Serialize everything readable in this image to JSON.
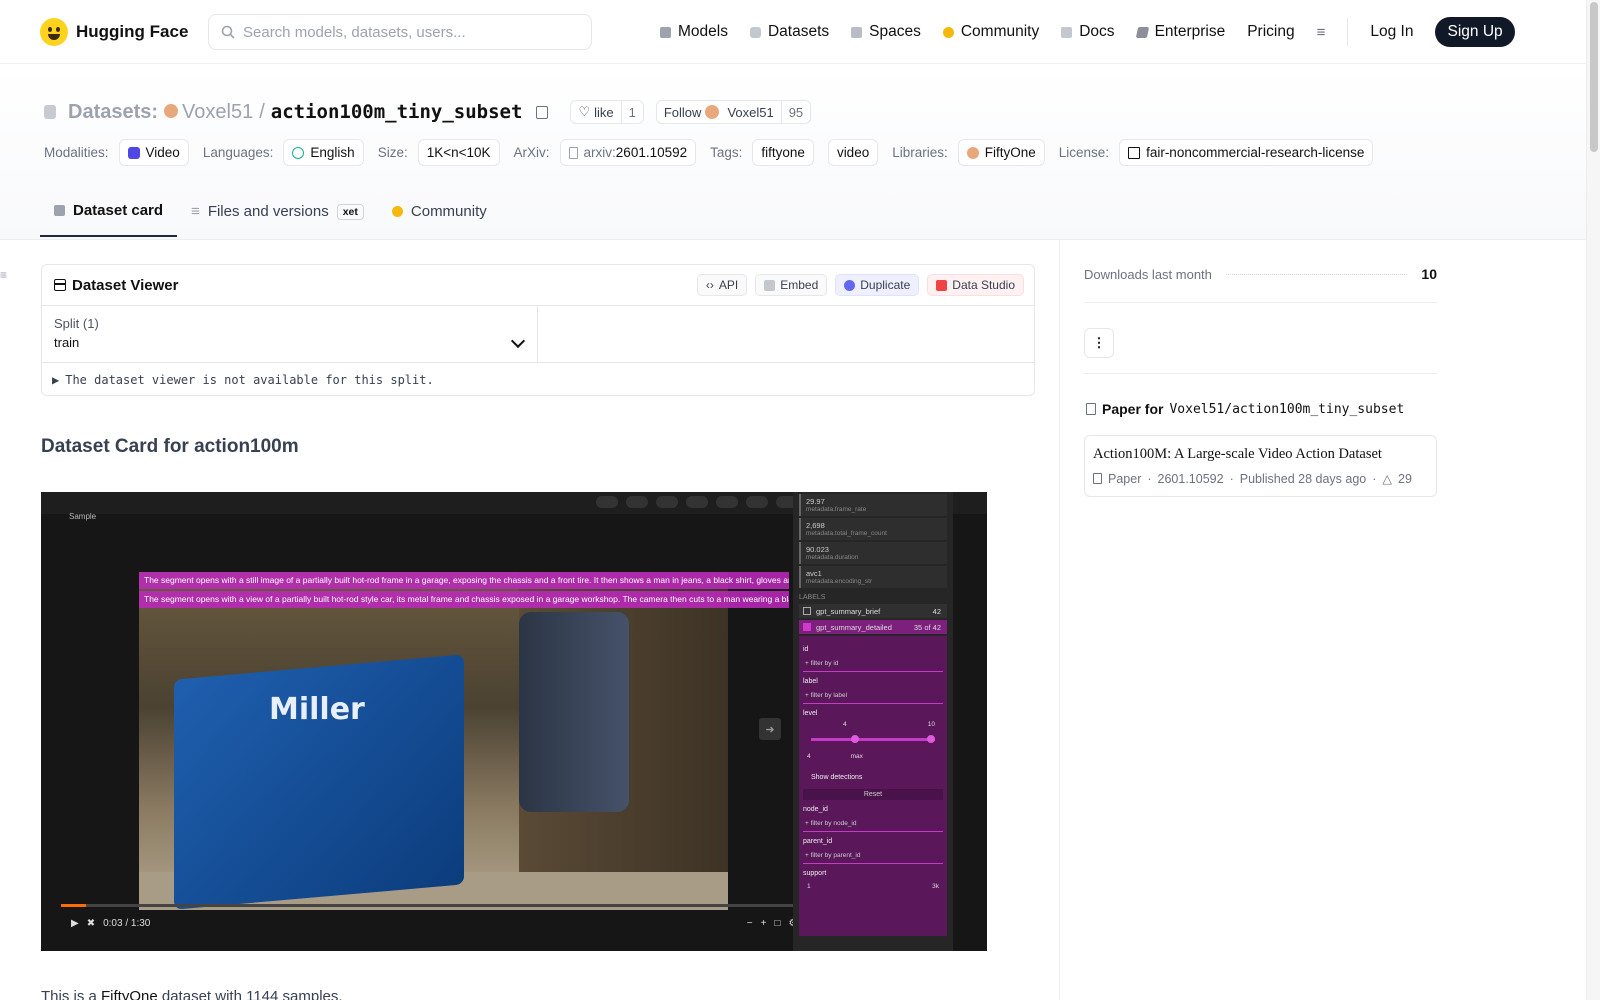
{
  "nav": {
    "brand": "Hugging Face",
    "search_placeholder": "Search models, datasets, users...",
    "links": [
      {
        "label": "Models",
        "icon": "cube-icon",
        "color": "#9ca3af"
      },
      {
        "label": "Datasets",
        "icon": "database-icon",
        "color": "#9ca3af"
      },
      {
        "label": "Spaces",
        "icon": "spaces-icon",
        "color": "#9ca3af"
      },
      {
        "label": "Community",
        "icon": "hug-icon",
        "color": "#f59e0b"
      },
      {
        "label": "Docs",
        "icon": "book-icon",
        "color": "#9ca3af"
      },
      {
        "label": "Enterprise",
        "icon": "enterprise-icon",
        "color": "#6b7280"
      },
      {
        "label": "Pricing"
      }
    ],
    "login": "Log In",
    "signup": "Sign Up"
  },
  "header": {
    "section": "Datasets:",
    "owner": "Voxel51",
    "slash": "/",
    "name": "action100m_tiny_subset",
    "like_label": "like",
    "like_count": "1",
    "follow_label": "Follow",
    "follow_org": "Voxel51",
    "follow_count": "95",
    "meta": {
      "modalities_label": "Modalities:",
      "modality": "Video",
      "languages_label": "Languages:",
      "language": "English",
      "size_label": "Size:",
      "size": "1K<n<10K",
      "arxiv_label": "ArXiv:",
      "arxiv_prefix": "arxiv:",
      "arxiv_id": "2601.10592",
      "tags_label": "Tags:",
      "tags": [
        "fiftyone",
        "video"
      ],
      "libraries_label": "Libraries:",
      "library": "FiftyOne",
      "license_label": "License:",
      "license": "fair-noncommercial-research-license"
    },
    "tabs": [
      {
        "label": "Dataset card",
        "active": true
      },
      {
        "label": "Files and versions",
        "badge": "xet"
      },
      {
        "label": "Community"
      }
    ]
  },
  "viewer": {
    "title": "Dataset Viewer",
    "buttons": [
      "API",
      "Embed",
      "Duplicate",
      "Data Studio"
    ],
    "split_label": "Split (1)",
    "split_value": "train",
    "note": "The dataset viewer is not available for this split."
  },
  "card": {
    "heading": "Dataset Card for action100m",
    "intro_prefix": "This is a ",
    "intro_link": "FiftyOne",
    "intro_suffix": " dataset with 1144 samples."
  },
  "screenshot": {
    "tab": "Sample",
    "overlay_lines": [
      "The segment opens with a still image of a partially built hot-rod frame in a garage, exposing the chassis and a front tire. It then shows a man in jeans, a black shirt, gloves and a we",
      "The segment opens with a view of a partially built hot-rod style car, its metal frame and chassis exposed in a garage workshop. The camera then cuts to a man wearing a black shi"
    ],
    "brand_on_machine": "Miller",
    "time": "0:03 / 1:30",
    "progress": 0.033,
    "stats": [
      {
        "value": "29.97",
        "key": "metadata.frame_rate"
      },
      {
        "value": "2,698",
        "key": "metadata.total_frame_count"
      },
      {
        "value": "90.023",
        "key": "metadata.duration"
      },
      {
        "value": "avc1",
        "key": "metadata.encoding_str"
      }
    ],
    "labels_head": "LABELS",
    "label_rows": [
      {
        "name": "gpt_summary_brief",
        "count": "42",
        "checked": false
      },
      {
        "name": "gpt_summary_detailed",
        "count": "35 of 42",
        "checked": true
      }
    ],
    "fields": [
      {
        "name": "id",
        "filter": "+ filter by id"
      },
      {
        "name": "label",
        "filter": "+ filter by label"
      }
    ],
    "level_label": "level",
    "level_min": "4",
    "level_max": "10",
    "level_inputs": [
      "4",
      "max"
    ],
    "show_detections": "Show detections",
    "reset": "Reset",
    "fields2": [
      {
        "name": "node_id",
        "filter": "+ filter by node_id"
      },
      {
        "name": "parent_id",
        "filter": "+ filter by parent_id"
      }
    ],
    "support_label": "support",
    "support_min": "1",
    "support_max": "3k"
  },
  "sidebar": {
    "downloads_label": "Downloads last month",
    "downloads": "10",
    "paper_for": "Paper for",
    "paper_repo": "Voxel51/action100m_tiny_subset",
    "paper_title": "Action100M: A Large-scale Video Action Dataset",
    "paper_kind": "Paper",
    "paper_id": "2601.10592",
    "paper_published": "Published 28 days ago",
    "paper_upvotes": "29"
  }
}
